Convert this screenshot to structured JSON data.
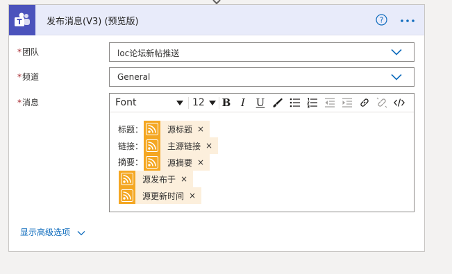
{
  "action": {
    "title": "发布消息(V3) (预览版)",
    "app_icon": "microsoft-teams-icon",
    "help_icon": "help-icon",
    "more_icon": "more-options-icon",
    "header_color": "#e8ebfa",
    "brand_color": "#4b53bc"
  },
  "fields": {
    "team": {
      "label": "团队",
      "required_mark": "*",
      "value": "loc论坛新帖推送"
    },
    "channel": {
      "label": "频道",
      "required_mark": "*",
      "value": "General"
    },
    "message": {
      "label": "消息",
      "required_mark": "*"
    }
  },
  "toolbar": {
    "font": "Font",
    "size": "12",
    "bold": "B",
    "italic": "I",
    "underline": "U"
  },
  "message_body": {
    "rows": [
      {
        "label": "标题：",
        "token": "源标题"
      },
      {
        "label": "链接：",
        "token": "主源链接"
      },
      {
        "label": "摘要：",
        "token": "源摘要"
      },
      {
        "label": "",
        "token": "源发布于"
      },
      {
        "label": "",
        "token": "源更新时间"
      }
    ],
    "token_close": "×",
    "token_icon": "rss-icon",
    "token_color": "#f4a723"
  },
  "advanced_link": "显示高级选项"
}
